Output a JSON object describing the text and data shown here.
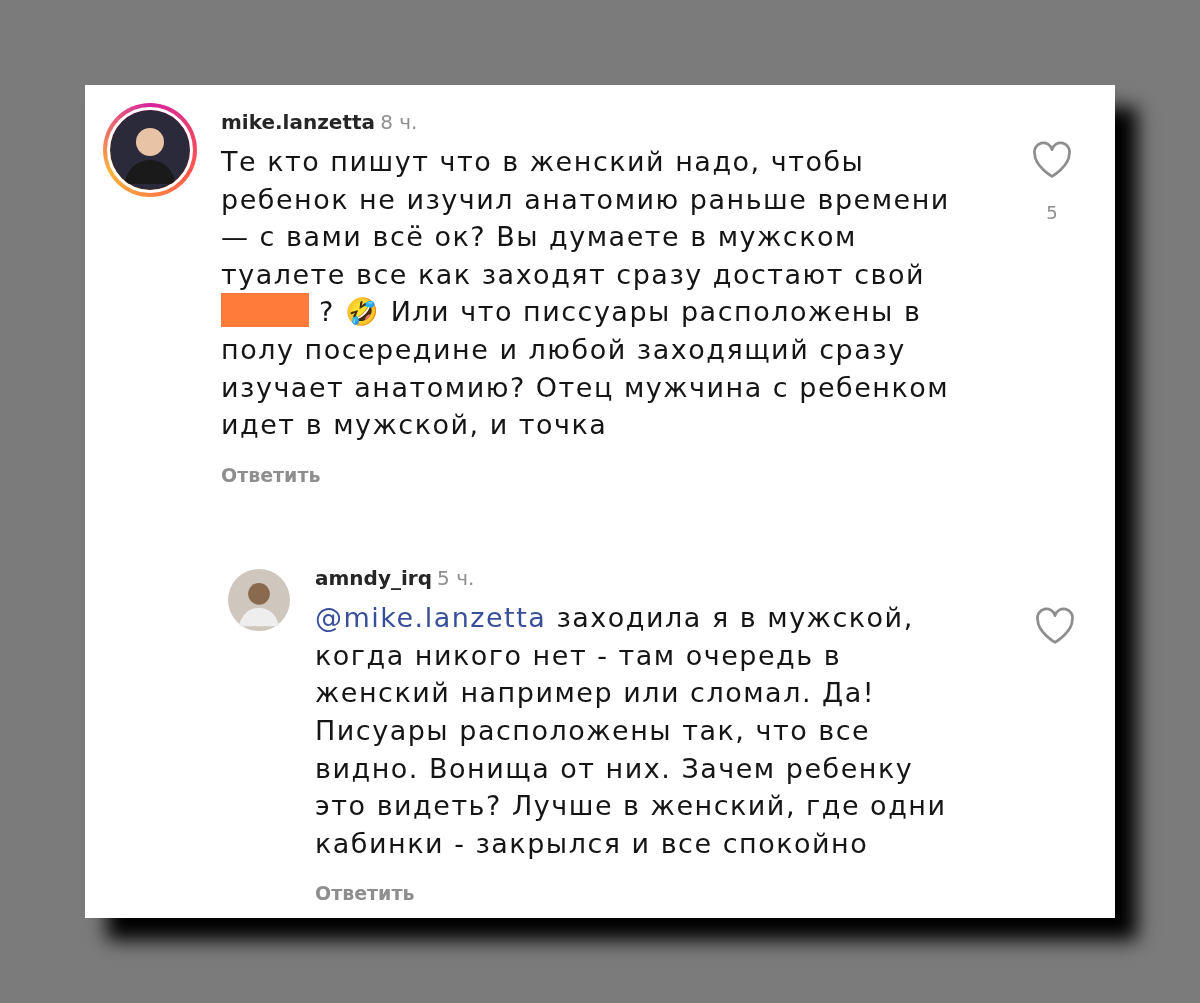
{
  "comments": [
    {
      "username": "mike.lanzetta",
      "time": "8 ч.",
      "has_story": true,
      "reply": false,
      "likes": "5",
      "reply_label": "Ответить",
      "lines": [
        [
          {
            "kind": "text",
            "text": "Те кто пишут что в женский надо, чтобы"
          }
        ],
        [
          {
            "kind": "text",
            "text": "ребенок не изучил анатомию раньше времени"
          }
        ],
        [
          {
            "kind": "text",
            "text": "— с вами всё ок? Вы думаете в мужском"
          }
        ],
        [
          {
            "kind": "text",
            "text": "туалете все как заходят сразу достают свой"
          }
        ],
        [
          {
            "kind": "redacted",
            "color": "#ff7b3a"
          },
          {
            "kind": "text",
            "text": "?"
          },
          {
            "kind": "emoji",
            "text": "🤣"
          },
          {
            "kind": "text",
            "text": "Или что писсуары расположены в"
          }
        ],
        [
          {
            "kind": "text",
            "text": "полу посередине и любой заходящий сразу"
          }
        ],
        [
          {
            "kind": "text",
            "text": "изучает анатомию? Отец мужчина с ребенком"
          }
        ],
        [
          {
            "kind": "text",
            "text": "идет в мужской, и точка"
          }
        ]
      ]
    },
    {
      "username": "amndy_irq",
      "time": "5 ч.",
      "has_story": false,
      "reply": true,
      "reply_label": "Ответить",
      "lines": [
        [
          {
            "kind": "mention",
            "text": "@mike.lanzetta"
          },
          {
            "kind": "text",
            "text": "заходила я в мужской,"
          }
        ],
        [
          {
            "kind": "text",
            "text": "когда никого нет - там очередь в"
          }
        ],
        [
          {
            "kind": "text",
            "text": "женский например или сломал. Да!"
          }
        ],
        [
          {
            "kind": "text",
            "text": "Писуары расположены так, что все"
          }
        ],
        [
          {
            "kind": "text",
            "text": "видно. Вонища от них. Зачем ребенку"
          }
        ],
        [
          {
            "kind": "text",
            "text": "это видеть? Лучше в женский, где одни"
          }
        ],
        [
          {
            "kind": "text",
            "text": "кабинки - закрылся и все спокойно"
          }
        ]
      ]
    }
  ]
}
